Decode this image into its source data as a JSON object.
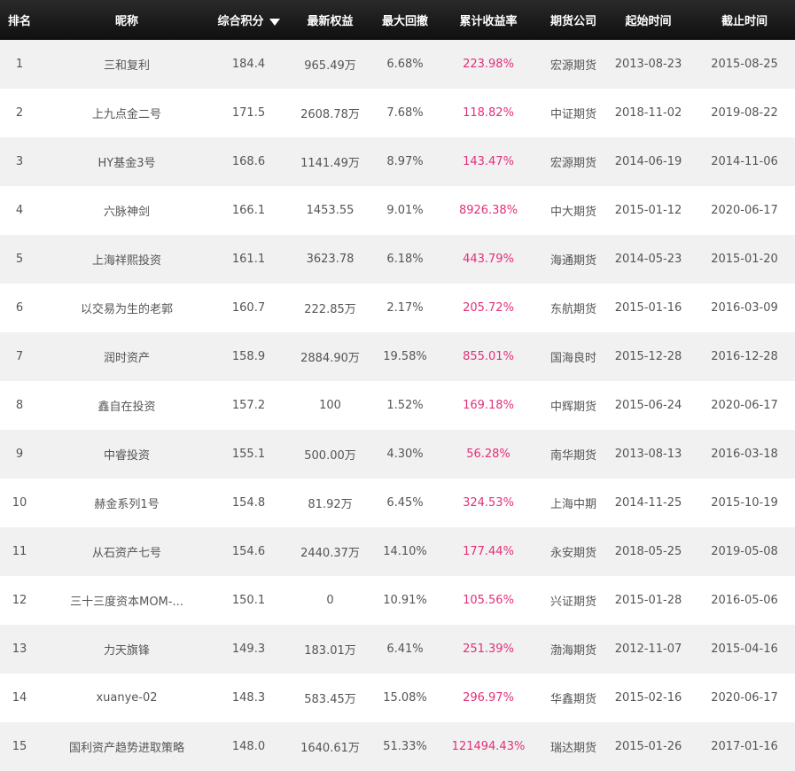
{
  "header": {
    "rank": "排名",
    "nickname": "昵称",
    "score": "综合积分",
    "equity": "最新权益",
    "drawdown": "最大回撤",
    "cum_return": "累计收益率",
    "broker": "期货公司",
    "start": "起始时间",
    "end": "截止时间"
  },
  "colors": {
    "return_highlight": "#e2307a",
    "header_bg": "#1a1a1a",
    "stripe": "#f1f1f1"
  },
  "rows": [
    {
      "rank": "1",
      "nickname": "三和复利",
      "score": "184.4",
      "equity": "965.49万",
      "drawdown": "6.68%",
      "cum_return": "223.98%",
      "broker": "宏源期货",
      "start": "2013-08-23",
      "end": "2015-08-25"
    },
    {
      "rank": "2",
      "nickname": "上九点金二号",
      "score": "171.5",
      "equity": "2608.78万",
      "drawdown": "7.68%",
      "cum_return": "118.82%",
      "broker": "中证期货",
      "start": "2018-11-02",
      "end": "2019-08-22"
    },
    {
      "rank": "3",
      "nickname": "HY基金3号",
      "score": "168.6",
      "equity": "1141.49万",
      "drawdown": "8.97%",
      "cum_return": "143.47%",
      "broker": "宏源期货",
      "start": "2014-06-19",
      "end": "2014-11-06"
    },
    {
      "rank": "4",
      "nickname": "六脉神剑",
      "score": "166.1",
      "equity": "1453.55",
      "drawdown": "9.01%",
      "cum_return": "8926.38%",
      "broker": "中大期货",
      "start": "2015-01-12",
      "end": "2020-06-17"
    },
    {
      "rank": "5",
      "nickname": "上海祥熙投资",
      "score": "161.1",
      "equity": "3623.78",
      "drawdown": "6.18%",
      "cum_return": "443.79%",
      "broker": "海通期货",
      "start": "2014-05-23",
      "end": "2015-01-20"
    },
    {
      "rank": "6",
      "nickname": "以交易为生的老郭",
      "score": "160.7",
      "equity": "222.85万",
      "drawdown": "2.17%",
      "cum_return": "205.72%",
      "broker": "东航期货",
      "start": "2015-01-16",
      "end": "2016-03-09"
    },
    {
      "rank": "7",
      "nickname": "润时资产",
      "score": "158.9",
      "equity": "2884.90万",
      "drawdown": "19.58%",
      "cum_return": "855.01%",
      "broker": "国海良时",
      "start": "2015-12-28",
      "end": "2016-12-28"
    },
    {
      "rank": "8",
      "nickname": "鑫自在投资",
      "score": "157.2",
      "equity": "100",
      "drawdown": "1.52%",
      "cum_return": "169.18%",
      "broker": "中辉期货",
      "start": "2015-06-24",
      "end": "2020-06-17"
    },
    {
      "rank": "9",
      "nickname": "中睿投资",
      "score": "155.1",
      "equity": "500.00万",
      "drawdown": "4.30%",
      "cum_return": "56.28%",
      "broker": "南华期货",
      "start": "2013-08-13",
      "end": "2016-03-18"
    },
    {
      "rank": "10",
      "nickname": "赫金系列1号",
      "score": "154.8",
      "equity": "81.92万",
      "drawdown": "6.45%",
      "cum_return": "324.53%",
      "broker": "上海中期",
      "start": "2014-11-25",
      "end": "2015-10-19"
    },
    {
      "rank": "11",
      "nickname": "从石资产七号",
      "score": "154.6",
      "equity": "2440.37万",
      "drawdown": "14.10%",
      "cum_return": "177.44%",
      "broker": "永安期货",
      "start": "2018-05-25",
      "end": "2019-05-08"
    },
    {
      "rank": "12",
      "nickname": "三十三度资本MOM-...",
      "score": "150.1",
      "equity": "0",
      "drawdown": "10.91%",
      "cum_return": "105.56%",
      "broker": "兴证期货",
      "start": "2015-01-28",
      "end": "2016-05-06"
    },
    {
      "rank": "13",
      "nickname": "力天旗锋",
      "score": "149.3",
      "equity": "183.01万",
      "drawdown": "6.41%",
      "cum_return": "251.39%",
      "broker": "渤海期货",
      "start": "2012-11-07",
      "end": "2015-04-16"
    },
    {
      "rank": "14",
      "nickname": "xuanye-02",
      "score": "148.3",
      "equity": "583.45万",
      "drawdown": "15.08%",
      "cum_return": "296.97%",
      "broker": "华鑫期货",
      "start": "2015-02-16",
      "end": "2020-06-17"
    },
    {
      "rank": "15",
      "nickname": "国利资产趋势进取策略",
      "score": "148.0",
      "equity": "1640.61万",
      "drawdown": "51.33%",
      "cum_return": "121494.43%",
      "broker": "瑞达期货",
      "start": "2015-01-26",
      "end": "2017-01-16"
    }
  ]
}
